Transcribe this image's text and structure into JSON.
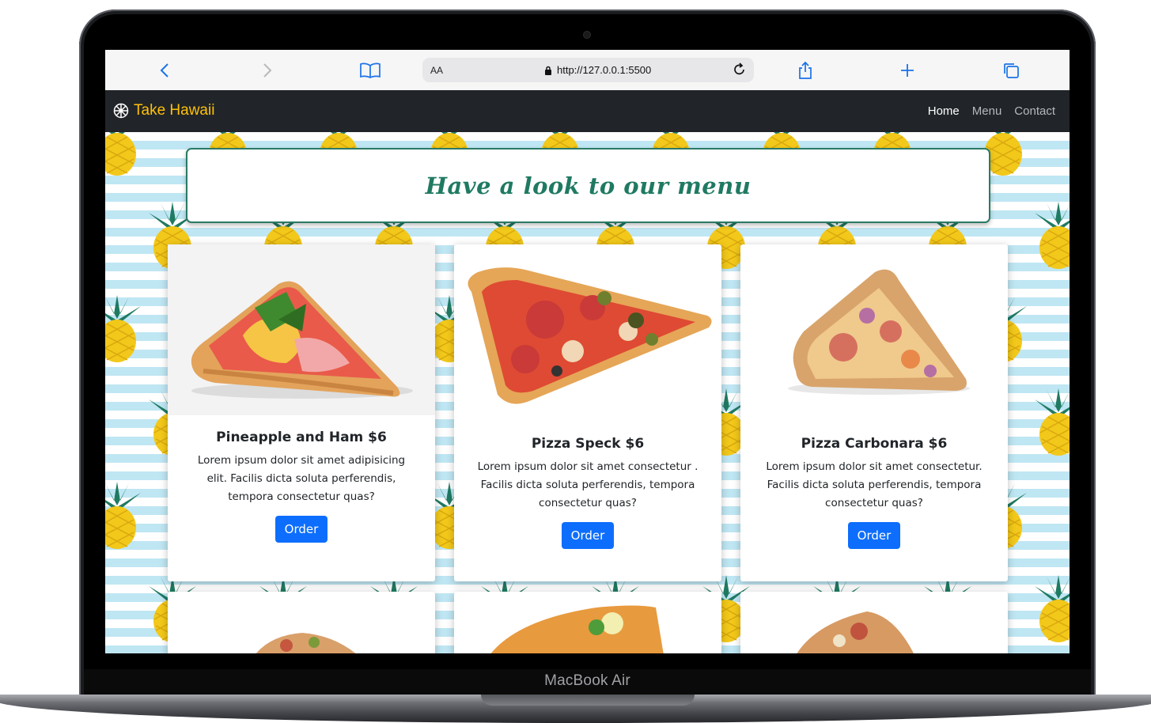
{
  "device": {
    "label": "MacBook Air"
  },
  "browser": {
    "aa_label": "AA",
    "url": "http://127.0.0.1:5500",
    "icons": [
      "back-icon",
      "forward-icon",
      "book-icon",
      "lock-icon",
      "reload-icon",
      "share-icon",
      "plus-icon",
      "tabs-icon"
    ]
  },
  "navbar": {
    "brand": "Take Hawaii",
    "links": [
      "Home",
      "Menu",
      "Contact"
    ]
  },
  "banner": {
    "title": "Have a look to our menu"
  },
  "cards": [
    {
      "title": "Pineapple and Ham $6",
      "text": "Lorem ipsum dolor sit amet adipisicing elit. Facilis dicta soluta perferendis, tempora consectetur quas?",
      "button": "Order"
    },
    {
      "title": "Pizza Speck $6",
      "text": "Lorem ipsum dolor sit amet consectetur . Facilis dicta soluta perferendis, tempora consectetur quas?",
      "button": "Order"
    },
    {
      "title": "Pizza Carbonara $6",
      "text": "Lorem ipsum dolor sit amet consectetur. Facilis dicta soluta perferendis, tempora consectetur quas?",
      "button": "Order"
    }
  ],
  "colors": {
    "brand": "#ffc107",
    "navbar_bg": "#212529",
    "button": "#0d6efd",
    "banner_text": "#1f7a62"
  }
}
